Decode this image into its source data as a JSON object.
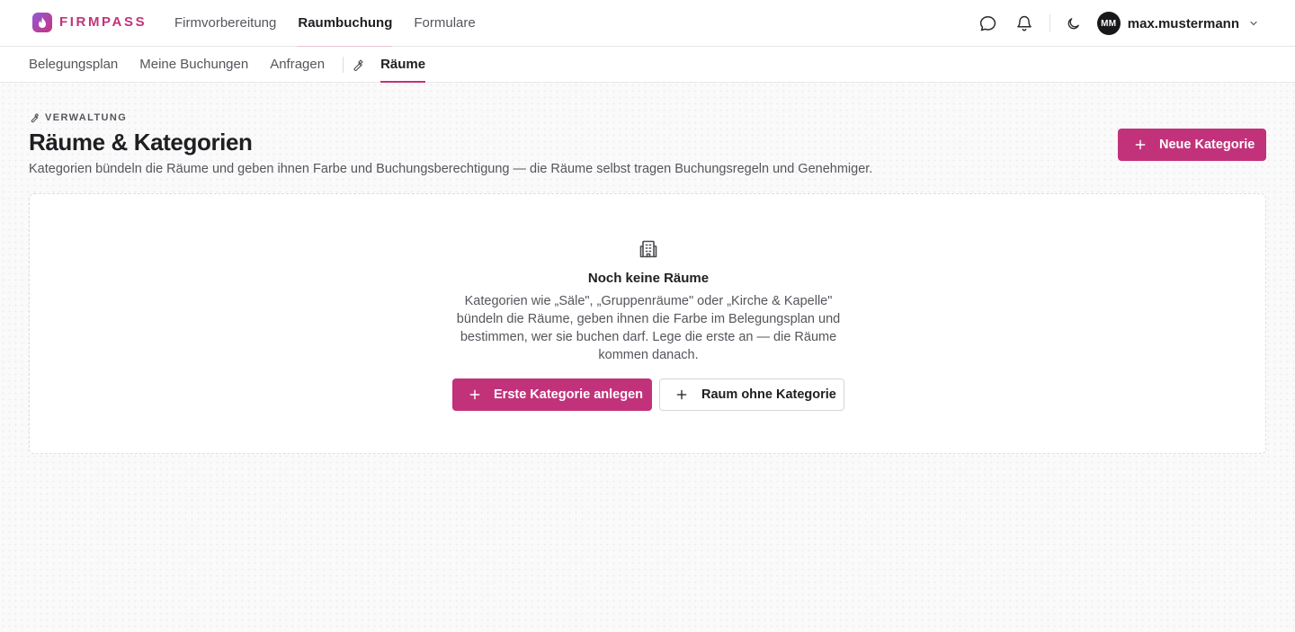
{
  "brand": {
    "name": "FIRMPASS",
    "accent": "#c2327a"
  },
  "main_nav": [
    {
      "label": "Firmvorbereitung",
      "active": false
    },
    {
      "label": "Raumbuchung",
      "active": true
    },
    {
      "label": "Formulare",
      "active": false
    }
  ],
  "user": {
    "initials": "MM",
    "name": "max.mustermann"
  },
  "sub_nav": {
    "tabs": [
      "Belegungsplan",
      "Meine Buchungen",
      "Anfragen"
    ],
    "admin_tab": "Räume"
  },
  "header": {
    "eyebrow": "VERWALTUNG",
    "title": "Räume & Kategorien",
    "subtitle": "Kategorien bündeln die Räume und geben ihnen Farbe und Buchungsberechtigung — die Räume selbst tragen Buchungsregeln und Genehmiger.",
    "new_button": "Neue Kategorie"
  },
  "empty_state": {
    "title": "Noch keine Räume",
    "text": "Kategorien wie „Säle\", „Gruppenräume\" oder „Kirche & Kapelle\" bündeln die Räume, geben ihnen die Farbe im Belegungsplan und bestimmen, wer sie buchen darf. Lege die erste an — die Räume kommen danach.",
    "primary_button": "Erste Kategorie anlegen",
    "secondary_button": "Raum ohne Kategorie"
  }
}
